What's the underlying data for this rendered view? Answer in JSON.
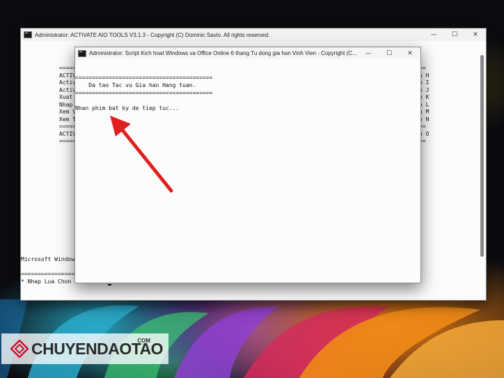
{
  "outer_window": {
    "title": "Administrator:  ACTIVATE AIO TOOLS V3.1.3 - Copyright (C) Dominic Savio. All rights reserved.",
    "minimize_glyph": "—",
    "maximize_glyph": "☐",
    "close_glyph": "✕",
    "lines_left": [
      "=====",
      "ACTIV",
      "Activ",
      "Activ",
      "Xuat",
      "Nhap",
      "Xem V",
      "Xem T",
      "=====",
      "ACTIV",
      "====="
    ],
    "lines_right": [
      "==",
      "n H",
      "n I",
      "n J",
      "n K",
      "n L",
      "n M",
      "n N",
      "==",
      "n O",
      "=="
    ],
    "bottom_line_1": "Microsoft Window",
    "bottom_line_2": "==================",
    "prompt_line": "* Nhap Lua Chon Cua Ban : "
  },
  "inner_window": {
    "title": "Administrator:  Script Kich hoat Windows va Office Online 6 thang Tu dong gia han Vinh Vien - Copyright (C...",
    "minimize_glyph": "—",
    "maximize_glyph": "☐",
    "close_glyph": "✕",
    "separator": "=========================================",
    "message": "    Da tao Tac vu Gia han Hang tuan.",
    "prompt": "Nhan phim bat ky de tiep tuc..."
  },
  "watermark": {
    "brand": "CHUYENDAOTAO",
    "suffix": "COM"
  },
  "colors": {
    "arrow": "#e02020",
    "logo_mark": "#c8102e"
  },
  "icons": [
    "cmd-icon",
    "arrow-annotation",
    "chuyendaotao-logo-icon"
  ]
}
